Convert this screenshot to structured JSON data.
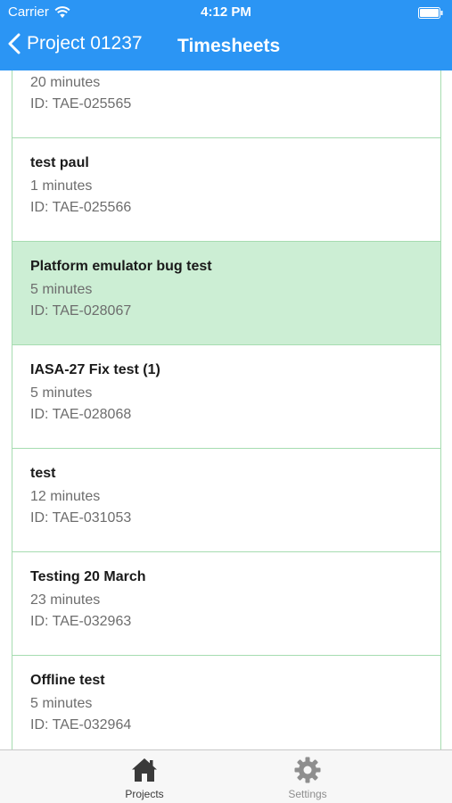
{
  "status_bar": {
    "carrier": "Carrier",
    "time": "4:12 PM",
    "icons": [
      "wifi-icon",
      "battery-icon"
    ]
  },
  "nav": {
    "back_label": "Project 01237",
    "title": "Timesheets",
    "back_icon": "chevron-left-icon"
  },
  "theme": {
    "nav_background": "#2b95f4",
    "row_border": "#a6dcb0",
    "selected_row_background": "#cceed4"
  },
  "timesheets": [
    {
      "title": "",
      "duration": "20 minutes",
      "id": "ID: TAE-025565"
    },
    {
      "title": "test paul",
      "duration": "1 minutes",
      "id": "ID: TAE-025566"
    },
    {
      "title": "Platform emulator bug test",
      "duration": "5 minutes",
      "id": "ID: TAE-028067",
      "selected": true
    },
    {
      "title": "IASA-27 Fix test (1)",
      "duration": "5 minutes",
      "id": "ID: TAE-028068"
    },
    {
      "title": "test",
      "duration": "12 minutes",
      "id": "ID: TAE-031053"
    },
    {
      "title": "Testing 20 March",
      "duration": "23 minutes",
      "id": "ID: TAE-032963"
    },
    {
      "title": "Offline test",
      "duration": "5 minutes",
      "id": "ID: TAE-032964"
    }
  ],
  "tab_bar": {
    "tabs": [
      {
        "label": "Projects",
        "icon": "home-icon",
        "active": true
      },
      {
        "label": "Settings",
        "icon": "gear-icon",
        "active": false
      }
    ]
  }
}
